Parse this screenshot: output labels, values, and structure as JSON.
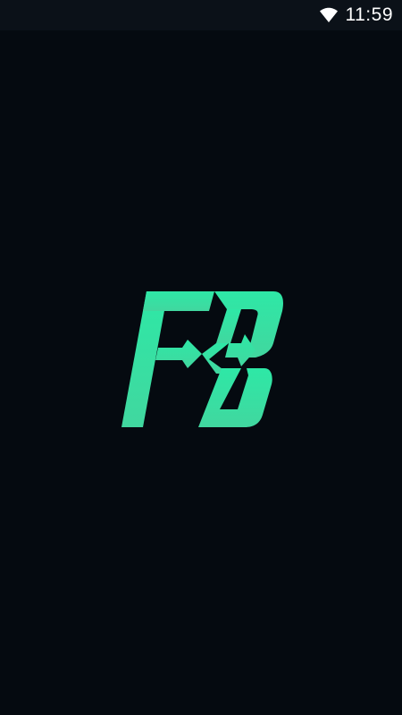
{
  "status_bar": {
    "time": "11:59",
    "wifi_icon": "wifi-icon"
  },
  "splash": {
    "logo_icon": "fb-logo-icon",
    "logo_gradient_top": "#2ee8a6",
    "logo_gradient_bottom": "#3ad79a"
  },
  "colors": {
    "background": "#050a10",
    "status_bar_background": "#0b1118",
    "status_text": "#ffffff"
  }
}
